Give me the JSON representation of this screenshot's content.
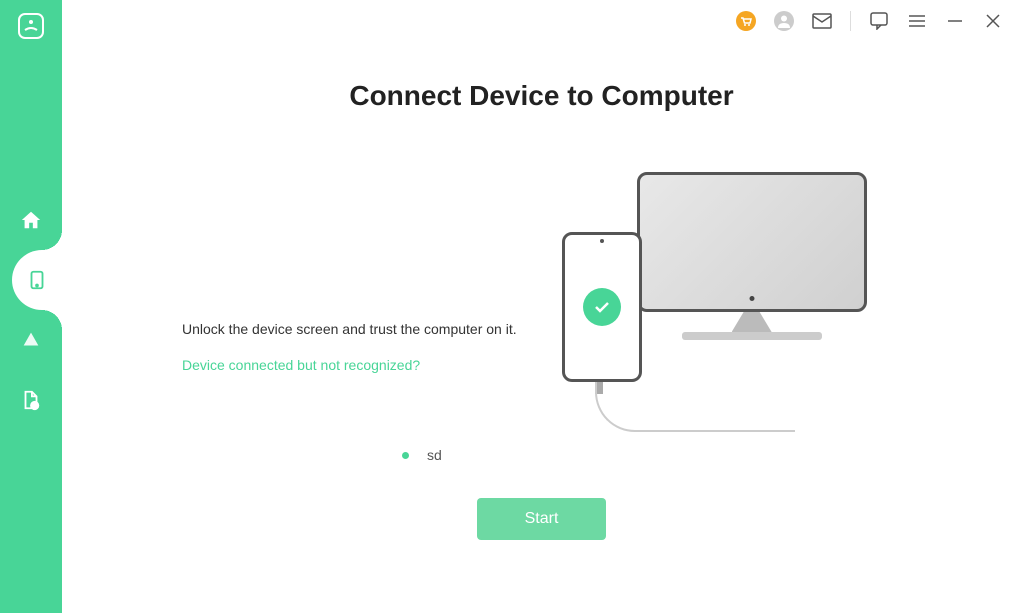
{
  "page": {
    "title": "Connect Device to Computer",
    "instruction": "Unlock the device screen and trust the computer on it.",
    "help_link": "Device connected but not recognized?"
  },
  "device": {
    "name": "sd",
    "connected": true
  },
  "actions": {
    "start_label": "Start"
  },
  "sidebar": {
    "items": [
      {
        "id": "home",
        "active": false
      },
      {
        "id": "device",
        "active": true
      },
      {
        "id": "cloud",
        "active": false
      },
      {
        "id": "file-alert",
        "active": false
      }
    ]
  },
  "colors": {
    "accent": "#48d597",
    "accent_light": "#6dd9a3",
    "titlebar_cart": "#f5a623"
  }
}
